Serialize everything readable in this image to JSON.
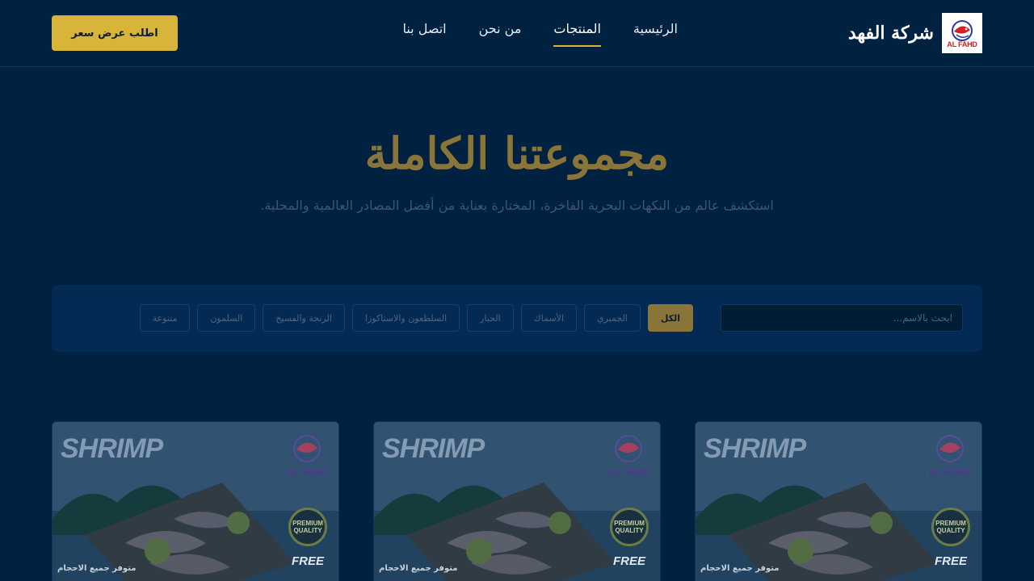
{
  "header": {
    "brand_name": "شركة الفهد",
    "logo_text": "AL FAHD",
    "nav": [
      {
        "label": "الرئيسية",
        "active": false
      },
      {
        "label": "المنتجات",
        "active": true
      },
      {
        "label": "من نحن",
        "active": false
      },
      {
        "label": "اتصل بنا",
        "active": false
      }
    ],
    "quote_button": "اطلب عرض سعر"
  },
  "hero": {
    "title": "مجموعتنا الكاملة",
    "subtitle": "استكشف عالم من النكهات البحرية الفاخرة، المختارة بعناية من أفضل المصادر العالمية والمحلية."
  },
  "filters": {
    "search_placeholder": "ابحث بالاسم...",
    "chips": [
      {
        "label": "الكل",
        "active": true
      },
      {
        "label": "الجمبري",
        "active": false
      },
      {
        "label": "الأسماك",
        "active": false
      },
      {
        "label": "الحبار",
        "active": false
      },
      {
        "label": "السلطعون والاستاكوزا",
        "active": false
      },
      {
        "label": "الرنجة والفسيخ",
        "active": false
      },
      {
        "label": "السلمون",
        "active": false
      },
      {
        "label": "متنوعة",
        "active": false
      }
    ]
  },
  "products": [
    {
      "word": "SHRIMP",
      "brand": "AL FAHD",
      "badge": "PREMIUM QUALITY",
      "free": "FREE",
      "caption": "متوفر جميع الاحجام"
    },
    {
      "word": "SHRIMP",
      "brand": "AL FAHD",
      "badge": "PREMIUM QUALITY",
      "free": "FREE",
      "caption": "متوفر جميع الاحجام"
    },
    {
      "word": "SHRIMP",
      "brand": "AL FAHD",
      "badge": "PREMIUM QUALITY",
      "free": "FREE",
      "caption": "متوفر جميع الاحجام"
    }
  ],
  "colors": {
    "background": "#002140",
    "accent": "#d9b43a",
    "panel": "#032a52"
  }
}
